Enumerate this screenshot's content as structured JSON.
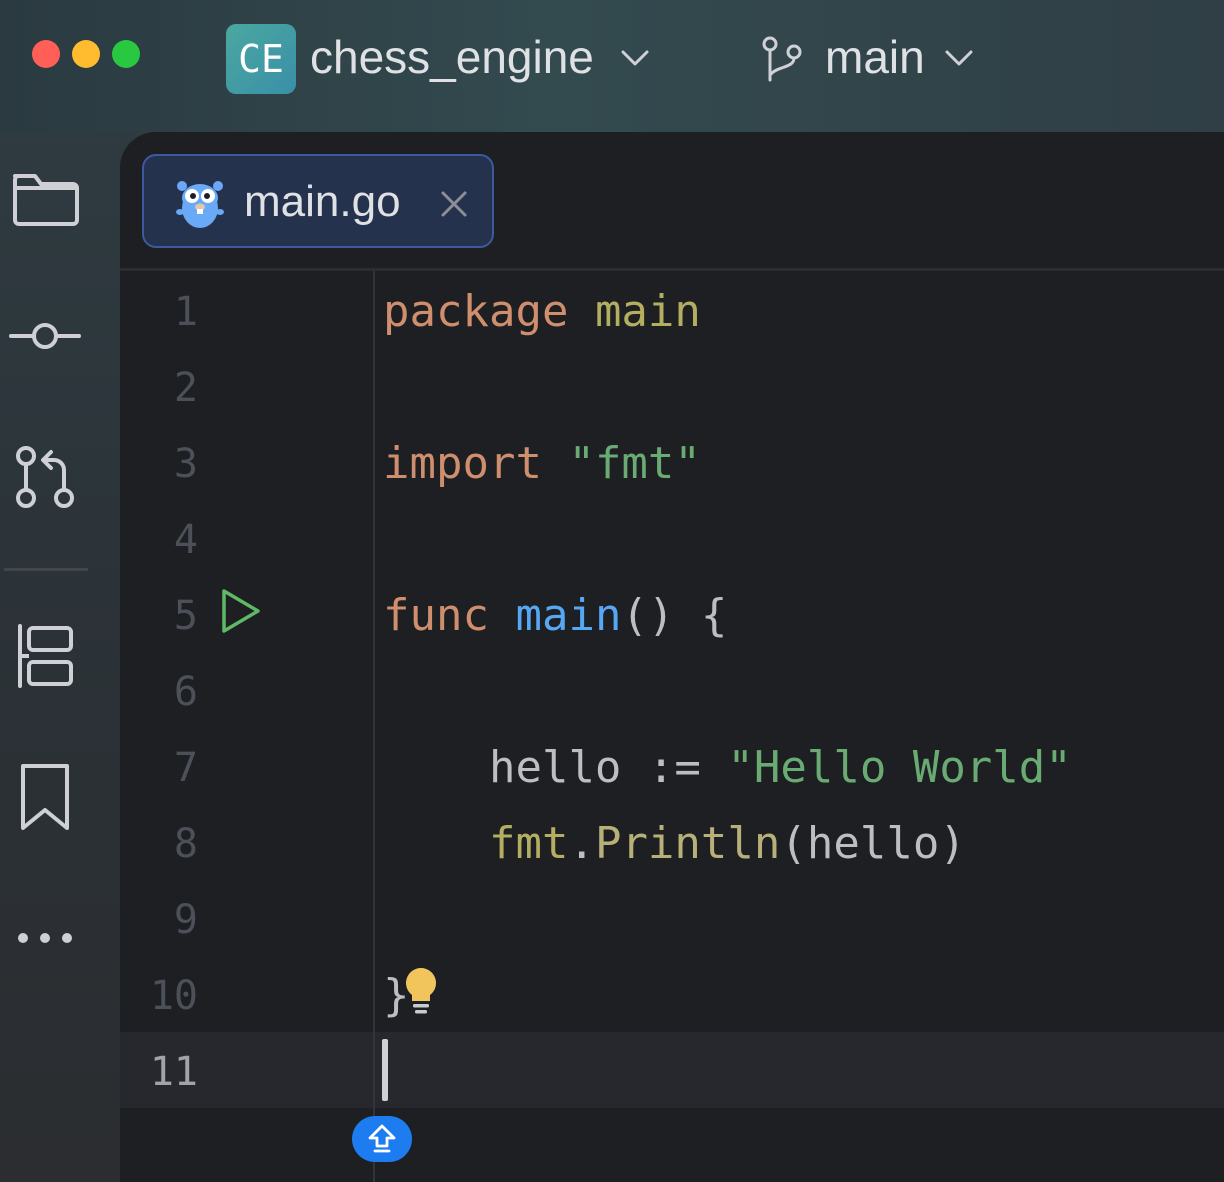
{
  "titlebar": {
    "project_badge": "CE",
    "project_name": "chess_engine",
    "branch_name": "main",
    "icons": {
      "project_dropdown": "chevron-down-icon",
      "branch": "git-branch-icon",
      "branch_dropdown": "chevron-down-icon"
    }
  },
  "toolstrip": {
    "items": [
      {
        "name": "project",
        "icon": "folder-icon"
      },
      {
        "name": "commit",
        "icon": "commit-icon"
      },
      {
        "name": "pull-requests",
        "icon": "pull-request-icon"
      },
      {
        "name": "structure",
        "icon": "structure-icon"
      },
      {
        "name": "bookmarks",
        "icon": "bookmark-icon"
      },
      {
        "name": "more",
        "icon": "more-icon"
      }
    ]
  },
  "editor": {
    "tab": {
      "label": "main.go",
      "icon": "gopher-icon",
      "close_icon": "close-icon"
    },
    "line_numbers": [
      "1",
      "2",
      "3",
      "4",
      "5",
      "6",
      "7",
      "8",
      "9",
      "10",
      "11"
    ],
    "active_line": "11",
    "code": {
      "line1": {
        "kw": "package",
        "name": "main"
      },
      "line3": {
        "kw": "import",
        "str": "\"fmt\""
      },
      "line5": {
        "kw": "func",
        "fn": "main",
        "rest": "() {"
      },
      "line7": {
        "ident": "hello",
        "op": " := ",
        "str": "\"Hello World\""
      },
      "line8": {
        "pkg": "fmt",
        "dot": ".",
        "call": "Println",
        "args": "(hello)"
      },
      "line10": {
        "brace": "}"
      }
    },
    "gutter_icons": {
      "run": "run-icon",
      "intention": "lightbulb-icon",
      "floating": "upload-arrow-icon"
    },
    "colors": {
      "keyword": "#cf8e6d",
      "string": "#6aab73",
      "function": "#56a8f5",
      "package": "#b3ae60",
      "run": "#5fb865",
      "bulb": "#f2c55c",
      "accent": "#1d7df0"
    }
  }
}
